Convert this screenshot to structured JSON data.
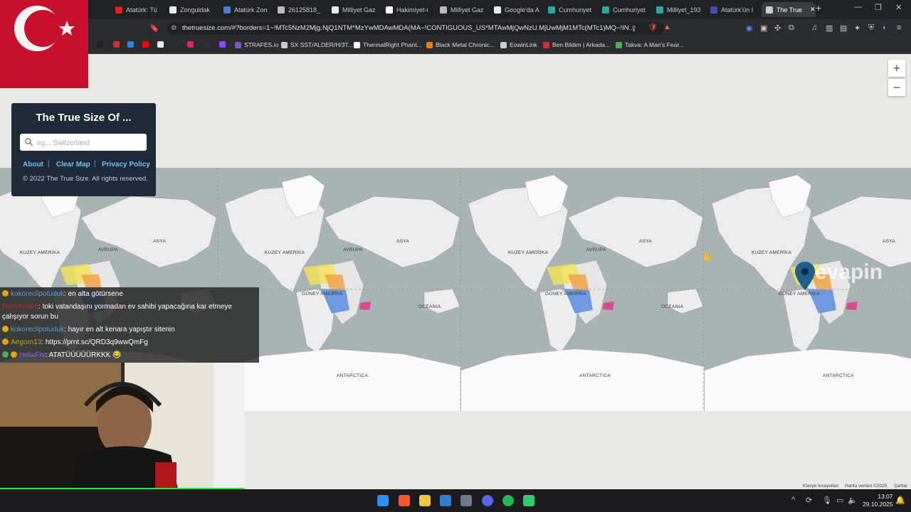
{
  "browser": {
    "tabs": [
      {
        "label": "Atatürk: Tü",
        "color": "#e62117"
      },
      {
        "label": "Zonguldak",
        "color": "#eaeaea"
      },
      {
        "label": "Atatürk Zon",
        "color": "#4a7fd4"
      },
      {
        "label": "26125818_",
        "color": "#bbbbbb"
      },
      {
        "label": "Milliyet Gaz",
        "color": "#eaeaea"
      },
      {
        "label": "Hakimiyet-i",
        "color": "#ffffff"
      },
      {
        "label": "Milliyet Gaz",
        "color": "#bbbbbb"
      },
      {
        "label": "Google'da A",
        "color": "#eaeaea"
      },
      {
        "label": "Cumhuriyet",
        "color": "#2aa9a1"
      },
      {
        "label": "Cumhuriyet",
        "color": "#2aa9a1"
      },
      {
        "label": "Milliyet_193",
        "color": "#2aa9a1"
      },
      {
        "label": "Atatürk'ün I",
        "color": "#3f51b5"
      },
      {
        "label": "The True",
        "color": "#cccccc"
      }
    ],
    "new_tab": "+",
    "url": "thetruesize.com/#?borders=1~!MTc5NzM2Mjg.NjQ1NTM*MzYwMDAwMDA(MA~!CONTIGUOUS_US*MTAwMjQwNzU.MjUwMjM1MTc(MTc1)MQ~!IN...",
    "bookmarks": [
      {
        "label": "",
        "color": "#222"
      },
      {
        "label": "",
        "color": "#d32f2f"
      },
      {
        "label": "",
        "color": "#1e88e5"
      },
      {
        "label": "",
        "color": "#ff0000"
      },
      {
        "label": "",
        "color": "#eee"
      },
      {
        "label": "",
        "color": "#e91e63"
      },
      {
        "label": "",
        "color": "#333"
      },
      {
        "label": "",
        "color": "#9146ff"
      },
      {
        "label": "STRAFES.io",
        "color": "#7e57c2"
      },
      {
        "label": "SX SST/ALDER/H/3T...",
        "color": "#ccc"
      },
      {
        "label": "ThermalRight Phant...",
        "color": "#fff"
      },
      {
        "label": "Black Metal Chronic...",
        "color": "#f57c00"
      },
      {
        "label": "EowinLink",
        "color": "#ccc"
      },
      {
        "label": "Ben Bildim | Arkada...",
        "color": "#d32f2f"
      },
      {
        "label": "Takva: A Man's Fear...",
        "color": "#4caf50"
      }
    ]
  },
  "panel": {
    "title": "The True Size Of ...",
    "search_placeholder": "eg... Switzerland",
    "links": [
      "About",
      "Clear Map",
      "Privacy Policy"
    ],
    "copyright": "© 2022 The True Size. All rights reserved."
  },
  "map": {
    "zoom_in": "+",
    "zoom_out": "−",
    "labels": [
      "KUZEY AMERİKA",
      "AVRUPA",
      "ASYA",
      "GÜNEY AMERİKA",
      "OCEANIA",
      "ANTARCTICA"
    ],
    "attribution": [
      "Klavye kısayolları",
      "Harita verileri ©2025",
      "Şartlar"
    ],
    "overlay_text": "evapin"
  },
  "chat": [
    {
      "user": "kokoreclipotuduk",
      "user_color": "#5b9bd5",
      "msg": ": en alta götürsene"
    },
    {
      "user": "Rockford06",
      "user_color": "#c62828",
      "msg": ": toki vatandaşını yormadan ev sahibi yapacağına kar etmeye çalışıyor sorun bu"
    },
    {
      "user": "kokoreclipotuduk",
      "user_color": "#5b9bd5",
      "msg": ": hayır en alt kenara yapıştır sitenin"
    },
    {
      "user": "Aegorn13",
      "user_color": "#c8a000",
      "msg": ": https://prnt.sc/QRD3q9wwQmFg"
    },
    {
      "user": "HelixFrv",
      "user_color": "#9c6ade",
      "msg": ": ATATÜÜÜÜÜRKKK 😂"
    }
  ],
  "taskbar": {
    "time": "13:07",
    "date": "29.10.2025"
  }
}
